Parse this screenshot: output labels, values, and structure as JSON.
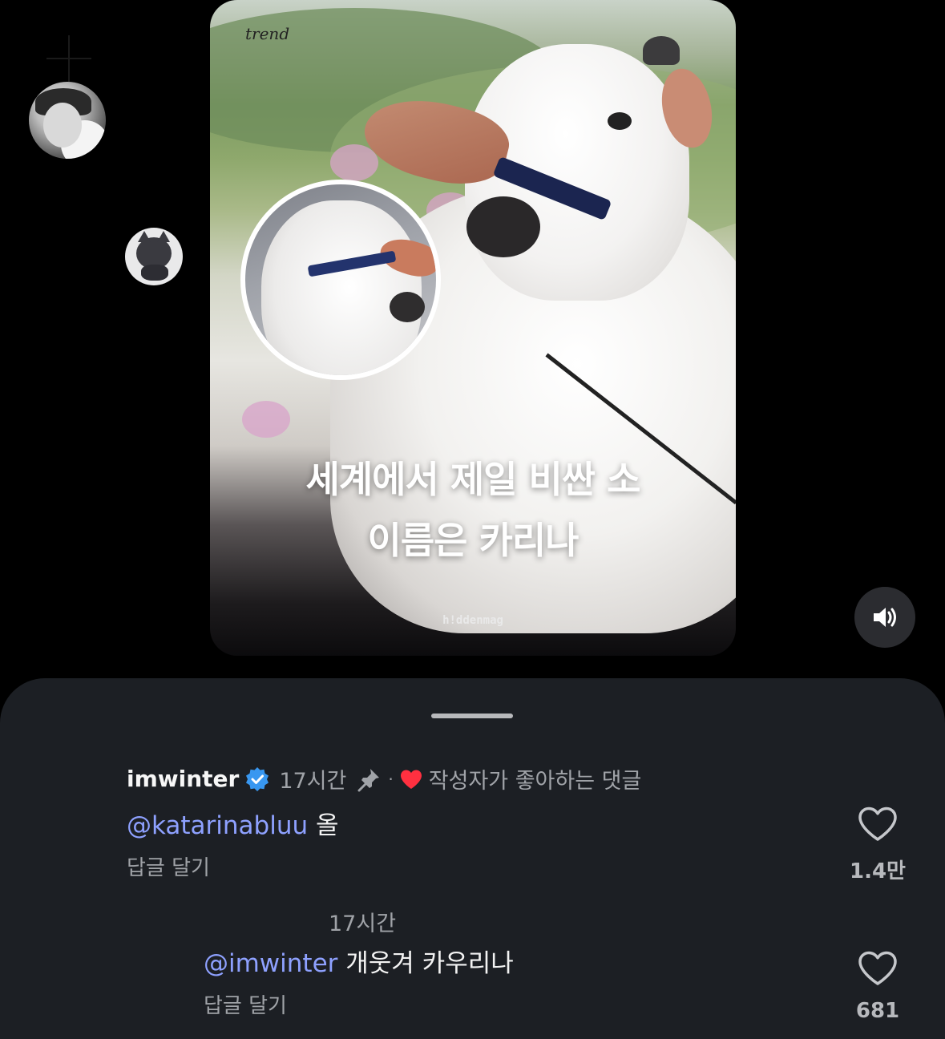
{
  "post": {
    "brand": "trend",
    "headline_line1": "세계에서 제일 비싼 소",
    "headline_line2": "이름은 카리나",
    "watermark": "h!ddenmag"
  },
  "controls": {
    "volume_icon": "speaker-volume-icon"
  },
  "comments": [
    {
      "username": "imwinter",
      "verified": true,
      "time": "17시간",
      "pinned": true,
      "separator": "·",
      "liked_by_author_label": "작성자가 좋아하는 댓글",
      "mention": "@katarinabluu",
      "text": " 올",
      "reply_label": "답글 달기",
      "likes": "1.4만"
    },
    {
      "username": "",
      "time": "17시간",
      "mention": "@imwinter",
      "text": " 개웃겨 카우리나",
      "reply_label": "답글 달기",
      "likes": "681"
    }
  ],
  "colors": {
    "sheet_bg": "#1c1f24",
    "mention": "#8ea1ff",
    "heart_red": "#ff3040",
    "verified_blue": "#3897f0"
  }
}
